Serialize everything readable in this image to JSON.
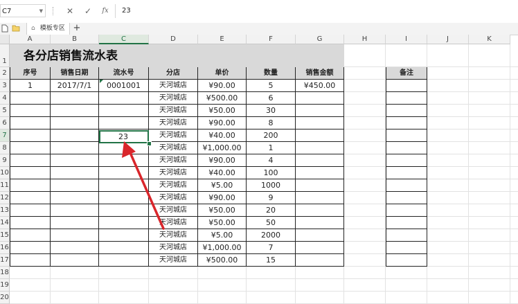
{
  "formula_bar": {
    "name_box": "C7",
    "formula_value": "23",
    "cancel_icon": "✕",
    "confirm_icon": "✓",
    "fx_icon": "fx"
  },
  "tab_bar": {
    "sheet_tab_label": "模板专区",
    "new_tab_icon": "+"
  },
  "sheet": {
    "columns": [
      "A",
      "B",
      "C",
      "D",
      "E",
      "F",
      "G",
      "H",
      "I",
      "J",
      "K"
    ],
    "rows": [
      "1",
      "2",
      "3",
      "4",
      "5",
      "6",
      "7",
      "8",
      "9",
      "10",
      "11",
      "12",
      "13",
      "14",
      "15",
      "16",
      "17",
      "18",
      "19",
      "20"
    ],
    "selected_column": "C",
    "selected_row": "7",
    "title": "各分店销售流水表",
    "headers": [
      "序号",
      "销售日期",
      "流水号",
      "分店",
      "单价",
      "数量",
      "销售金额"
    ],
    "remark_header": "备注",
    "data_rows": [
      {
        "seq": "1",
        "date": "2017/7/1",
        "serial": "0001001",
        "store": "天河城店",
        "price": "¥90.00",
        "qty": "5",
        "amount": "¥450.00"
      },
      {
        "seq": "",
        "date": "",
        "serial": "",
        "store": "天河城店",
        "price": "¥500.00",
        "qty": "6",
        "amount": ""
      },
      {
        "seq": "",
        "date": "",
        "serial": "",
        "store": "天河城店",
        "price": "¥50.00",
        "qty": "30",
        "amount": ""
      },
      {
        "seq": "",
        "date": "",
        "serial": "",
        "store": "天河城店",
        "price": "¥90.00",
        "qty": "8",
        "amount": ""
      },
      {
        "seq": "",
        "date": "",
        "serial": "23",
        "store": "天河城店",
        "price": "¥40.00",
        "qty": "200",
        "amount": ""
      },
      {
        "seq": "",
        "date": "",
        "serial": "",
        "store": "天河城店",
        "price": "¥1,000.00",
        "qty": "1",
        "amount": ""
      },
      {
        "seq": "",
        "date": "",
        "serial": "",
        "store": "天河城店",
        "price": "¥90.00",
        "qty": "4",
        "amount": ""
      },
      {
        "seq": "",
        "date": "",
        "serial": "",
        "store": "天河城店",
        "price": "¥40.00",
        "qty": "100",
        "amount": ""
      },
      {
        "seq": "",
        "date": "",
        "serial": "",
        "store": "天河城店",
        "price": "¥5.00",
        "qty": "1000",
        "amount": ""
      },
      {
        "seq": "",
        "date": "",
        "serial": "",
        "store": "天河城店",
        "price": "¥90.00",
        "qty": "9",
        "amount": ""
      },
      {
        "seq": "",
        "date": "",
        "serial": "",
        "store": "天河城店",
        "price": "¥50.00",
        "qty": "20",
        "amount": ""
      },
      {
        "seq": "",
        "date": "",
        "serial": "",
        "store": "天河城店",
        "price": "¥50.00",
        "qty": "50",
        "amount": ""
      },
      {
        "seq": "",
        "date": "",
        "serial": "",
        "store": "天河城店",
        "price": "¥5.00",
        "qty": "2000",
        "amount": ""
      },
      {
        "seq": "",
        "date": "",
        "serial": "",
        "store": "天河城店",
        "price": "¥1,000.00",
        "qty": "7",
        "amount": ""
      },
      {
        "seq": "",
        "date": "",
        "serial": "",
        "store": "天河城店",
        "price": "¥500.00",
        "qty": "15",
        "amount": ""
      }
    ]
  },
  "colors": {
    "accent_green": "#217346",
    "header_fill": "#d9d9d9",
    "arrow_red": "#d9262b"
  }
}
